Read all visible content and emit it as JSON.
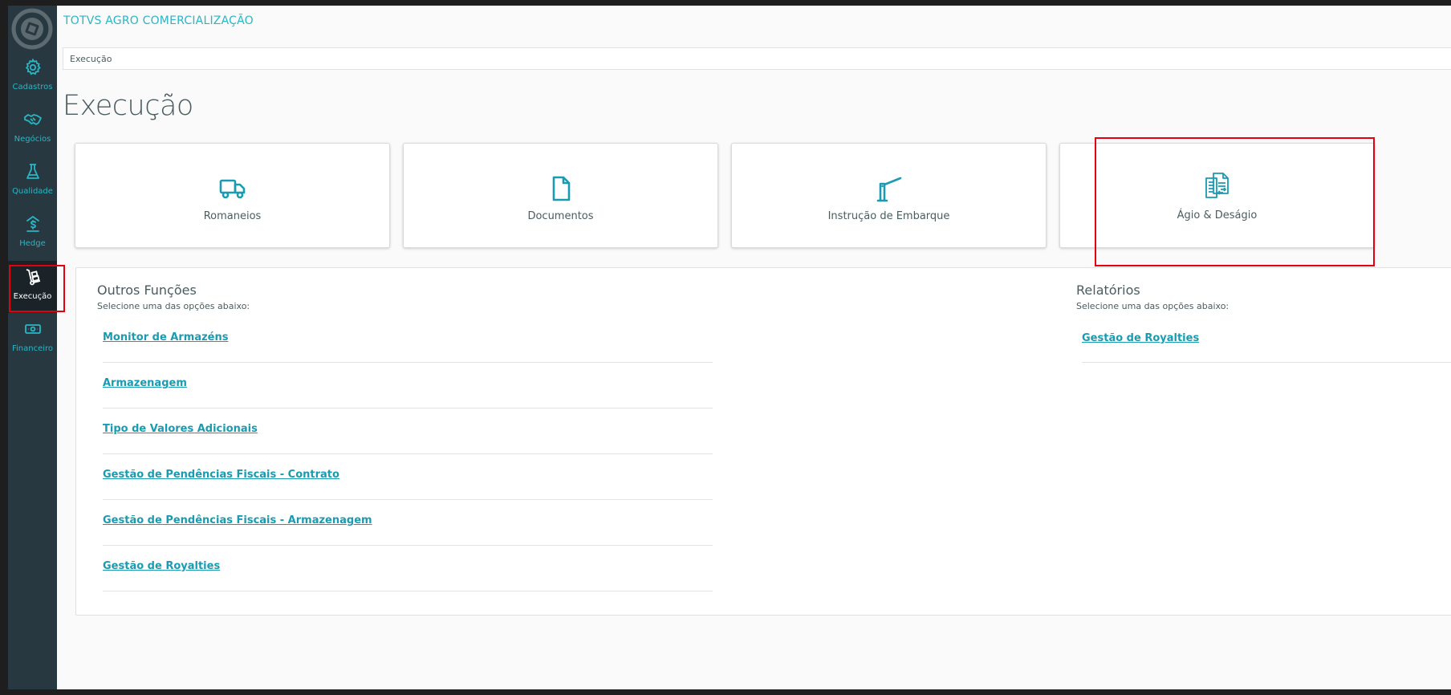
{
  "app": {
    "title": "TOTVS AGRO COMERCIALIZAÇÃO"
  },
  "sidebar": {
    "items": [
      {
        "label": "Cadastros",
        "icon": "gear-icon"
      },
      {
        "label": "Negócios",
        "icon": "handshake-icon"
      },
      {
        "label": "Qualidade",
        "icon": "flask-icon"
      },
      {
        "label": "Hedge",
        "icon": "hedge-icon"
      },
      {
        "label": "Execução",
        "icon": "hand-truck-icon",
        "active": true
      },
      {
        "label": "Financeiro",
        "icon": "money-icon"
      }
    ]
  },
  "breadcrumb": {
    "current": "Execução"
  },
  "page": {
    "title": "Execução"
  },
  "cards": [
    {
      "label": "Romaneios",
      "icon": "truck-icon"
    },
    {
      "label": "Documentos",
      "icon": "document-icon"
    },
    {
      "label": "Instrução de Embarque",
      "icon": "barrier-gate-icon"
    },
    {
      "label": "Ágio & Deságio",
      "icon": "files-exchange-icon"
    }
  ],
  "outros": {
    "title": "Outros Funções",
    "subtitle": "Selecione uma das opções abaixo:",
    "links": [
      "Monitor de Armazéns",
      "Armazenagem",
      "Tipo de Valores Adicionais",
      "Gestão de Pendências Fiscais - Contrato",
      "Gestão de Pendências Fiscais - Armazenagem",
      "Gestão de Royalties"
    ]
  },
  "relatorios": {
    "title": "Relatórios",
    "subtitle": "Selecione uma das opções abaixo:",
    "links": [
      "Gestão de Royalties"
    ]
  },
  "colors": {
    "accent": "#29b6c5",
    "link": "#1a9bb1",
    "sidebar": "#283840",
    "highlight": "#e3000f"
  }
}
